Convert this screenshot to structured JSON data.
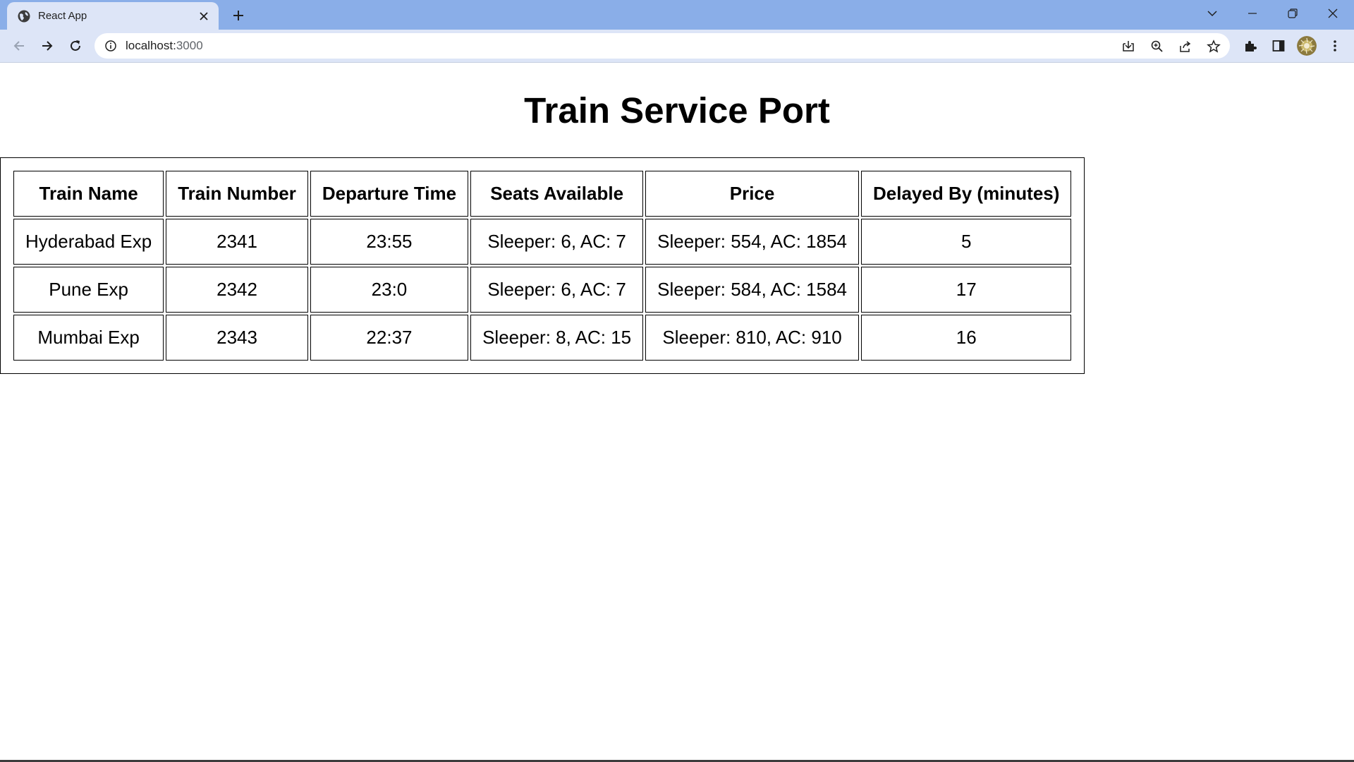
{
  "browser": {
    "tab_title": "React App",
    "url_host": "localhost:",
    "url_port": "3000",
    "colors": {
      "titlebar": "#8aaee8",
      "toolbar": "#dde5f7",
      "tab_active": "#dde5f7"
    },
    "icons": {
      "favicon": "globe-icon",
      "close": "close-icon",
      "new_tab": "plus-icon",
      "tab_search": "chevron-down-icon",
      "minimize": "minimize-icon",
      "restore": "restore-icon",
      "window_close": "close-icon",
      "back": "back-arrow-icon",
      "forward": "forward-arrow-icon",
      "reload": "reload-icon",
      "site_info": "info-icon",
      "install": "install-icon",
      "zoom": "zoom-icon",
      "share": "share-icon",
      "bookmark": "star-icon",
      "extensions": "puzzle-icon",
      "side_panel": "side-panel-icon",
      "profile": "avatar",
      "menu": "kebab-menu-icon"
    }
  },
  "page": {
    "title": "Train Service Port",
    "table": {
      "headers": [
        "Train Name",
        "Train Number",
        "Departure Time",
        "Seats Available",
        "Price",
        "Delayed By (minutes)"
      ],
      "rows": [
        [
          "Hyderabad Exp",
          "2341",
          "23:55",
          "Sleeper: 6, AC: 7",
          "Sleeper: 554, AC: 1854",
          "5"
        ],
        [
          "Pune Exp",
          "2342",
          "23:0",
          "Sleeper: 6, AC: 7",
          "Sleeper: 584, AC: 1584",
          "17"
        ],
        [
          "Mumbai Exp",
          "2343",
          "22:37",
          "Sleeper: 8, AC: 15",
          "Sleeper: 810, AC: 910",
          "16"
        ]
      ]
    }
  }
}
